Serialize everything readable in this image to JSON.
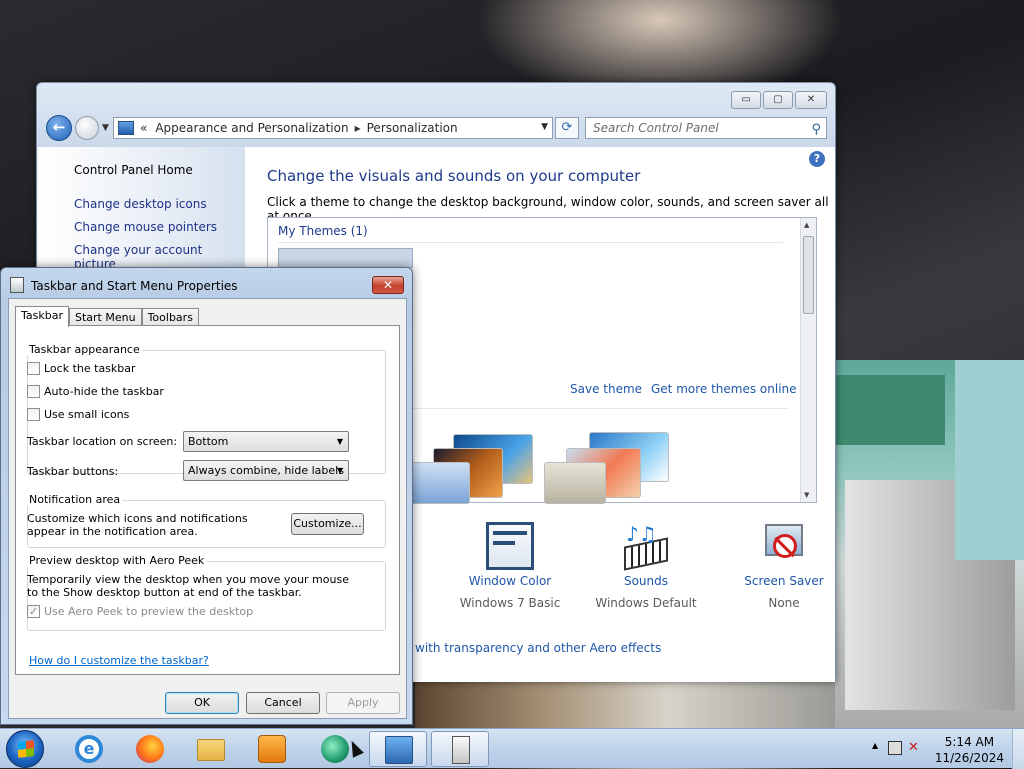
{
  "control_panel": {
    "breadcrumb": [
      "«",
      "Appearance and Personalization",
      "Personalization"
    ],
    "search_placeholder": "Search Control Panel",
    "sidebar": {
      "home": "Control Panel Home",
      "links": [
        "Change desktop icons",
        "Change mouse pointers",
        "Change your account picture"
      ]
    },
    "title": "Change the visuals and sounds on your computer",
    "subtitle": "Click a theme to change the desktop background, window color, sounds, and screen saver all at once.",
    "my_themes": "My Themes (1)",
    "save_theme": "Save theme",
    "get_more_themes": "Get more themes online",
    "items": [
      {
        "label": "Window Color",
        "value": "Windows 7 Basic"
      },
      {
        "label": "Sounds",
        "value": "Windows Default"
      },
      {
        "label": "Screen Saver",
        "value": "None"
      }
    ],
    "aero_link": "with transparency and other Aero effects",
    "window_buttons": {
      "minimize": "▭",
      "maximize": "▢",
      "close": "✕"
    }
  },
  "dialog": {
    "title": "Taskbar and Start Menu Properties",
    "close": "✕",
    "tabs": [
      "Taskbar",
      "Start Menu",
      "Toolbars"
    ],
    "active_tab": "Taskbar",
    "appearance": {
      "heading": "Taskbar appearance",
      "lock": {
        "label": "Lock the taskbar",
        "checked": false
      },
      "autohide": {
        "label": "Auto-hide the taskbar",
        "checked": false
      },
      "small_icons": {
        "label": "Use small icons",
        "checked": false
      },
      "location_label": "Taskbar location on screen:",
      "location_value": "Bottom",
      "buttons_label": "Taskbar buttons:",
      "buttons_value": "Always combine, hide labels"
    },
    "notification": {
      "heading": "Notification area",
      "text": "Customize which icons and notifications appear in the notification area.",
      "button": "Customize..."
    },
    "aero_peek": {
      "heading": "Preview desktop with Aero Peek",
      "text": "Temporarily view the desktop when you move your mouse to the Show desktop button at end of the taskbar.",
      "checkbox": {
        "label": "Use Aero Peek to preview the desktop",
        "checked": true,
        "disabled": true
      }
    },
    "help_link": "How do I customize the taskbar?",
    "buttons": {
      "ok": "OK",
      "cancel": "Cancel",
      "apply": "Apply"
    }
  },
  "taskbar": {
    "pinned": [
      "internet-explorer",
      "firefox",
      "file-explorer",
      "media-player",
      "app-green",
      "control-panel",
      "taskbar-properties"
    ],
    "clock_time": "5:14 AM",
    "clock_date": "11/26/2024"
  }
}
